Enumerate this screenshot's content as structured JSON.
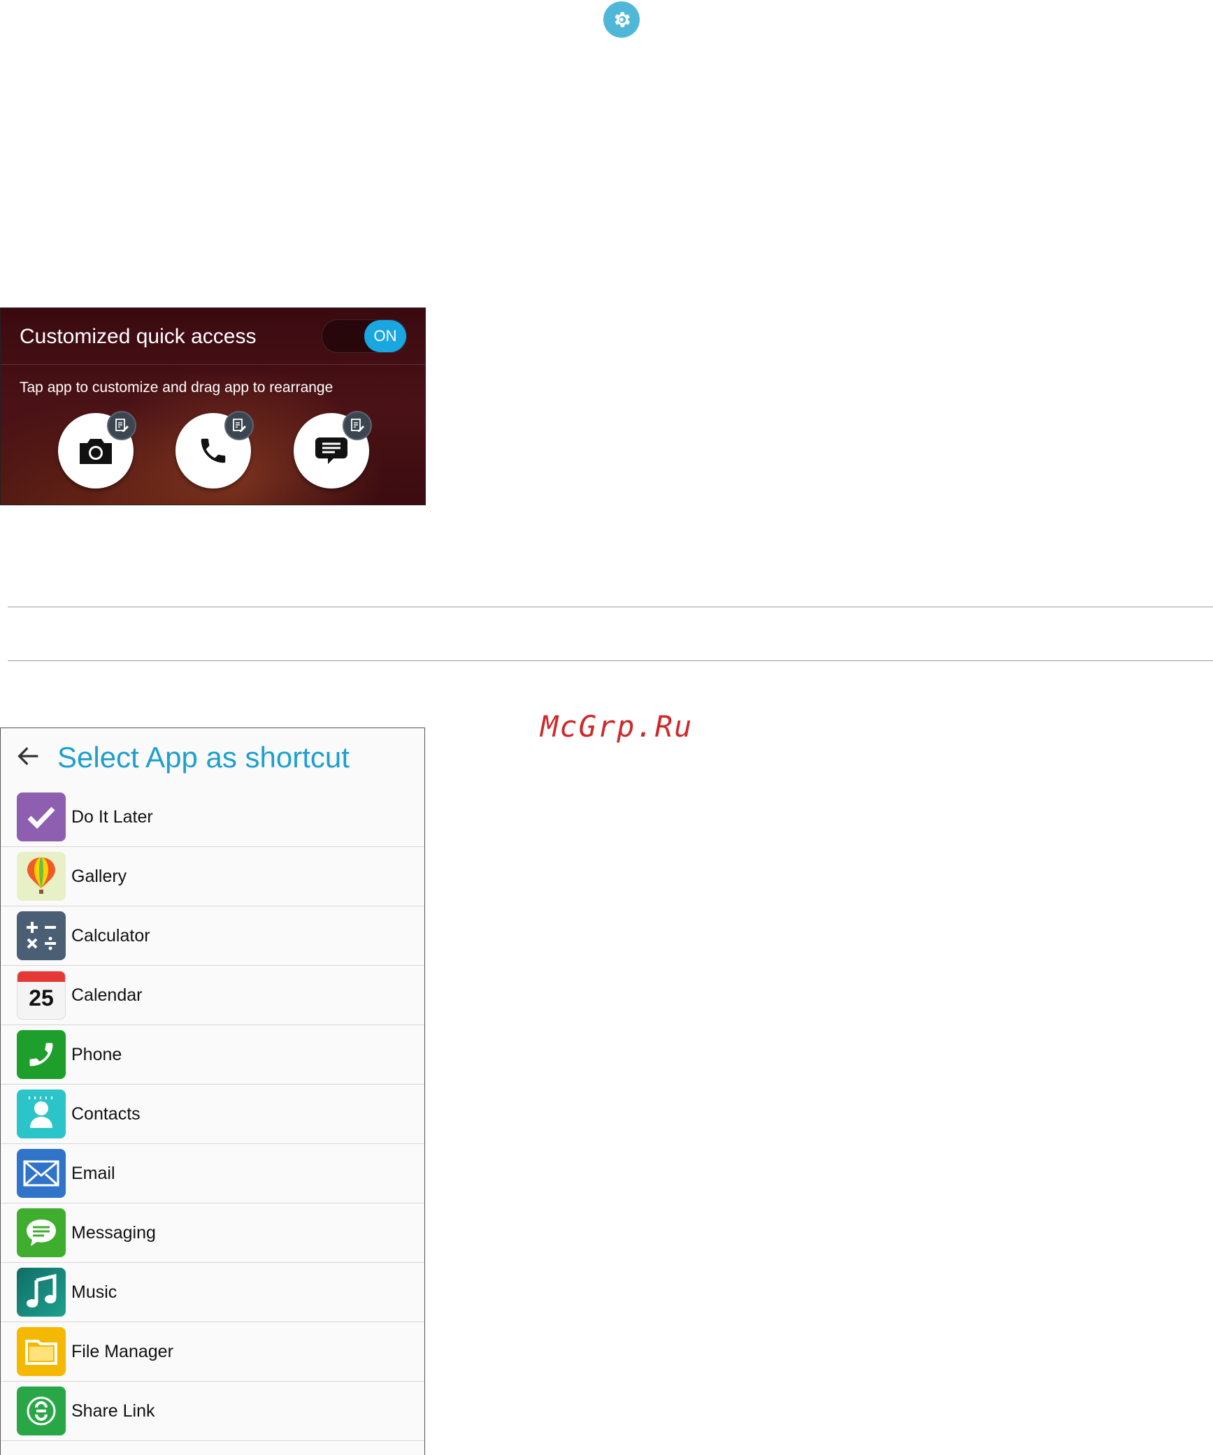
{
  "quick_access": {
    "title": "Customized quick access",
    "toggle_label": "ON",
    "subtitle": "Tap app to customize and drag app to rearrange",
    "apps": [
      {
        "icon": "camera-icon"
      },
      {
        "icon": "phone-icon"
      },
      {
        "icon": "message-icon"
      }
    ]
  },
  "watermark": "McGrp.Ru",
  "select_app": {
    "title": "Select App as shortcut",
    "calendar_day": "25",
    "items": [
      {
        "label": "Do It Later",
        "icon": "do-it-later-icon",
        "color": "#8e5fb0"
      },
      {
        "label": "Gallery",
        "icon": "gallery-icon",
        "color": "#e8f0c8"
      },
      {
        "label": "Calculator",
        "icon": "calculator-icon",
        "color": "#4a5f74"
      },
      {
        "label": "Calendar",
        "icon": "calendar-icon",
        "color": "#f4f4f4"
      },
      {
        "label": "Phone",
        "icon": "phone-icon",
        "color": "#1e9e2a"
      },
      {
        "label": "Contacts",
        "icon": "contacts-icon",
        "color": "#2bc4c8"
      },
      {
        "label": "Email",
        "icon": "email-icon",
        "color": "#2f74c9"
      },
      {
        "label": "Messaging",
        "icon": "messaging-icon",
        "color": "#3fae2e"
      },
      {
        "label": "Music",
        "icon": "music-icon",
        "color": "#15827a"
      },
      {
        "label": "File Manager",
        "icon": "file-manager-icon",
        "color": "#f5b800"
      },
      {
        "label": "Share Link",
        "icon": "share-link-icon",
        "color": "#29a746"
      }
    ]
  }
}
